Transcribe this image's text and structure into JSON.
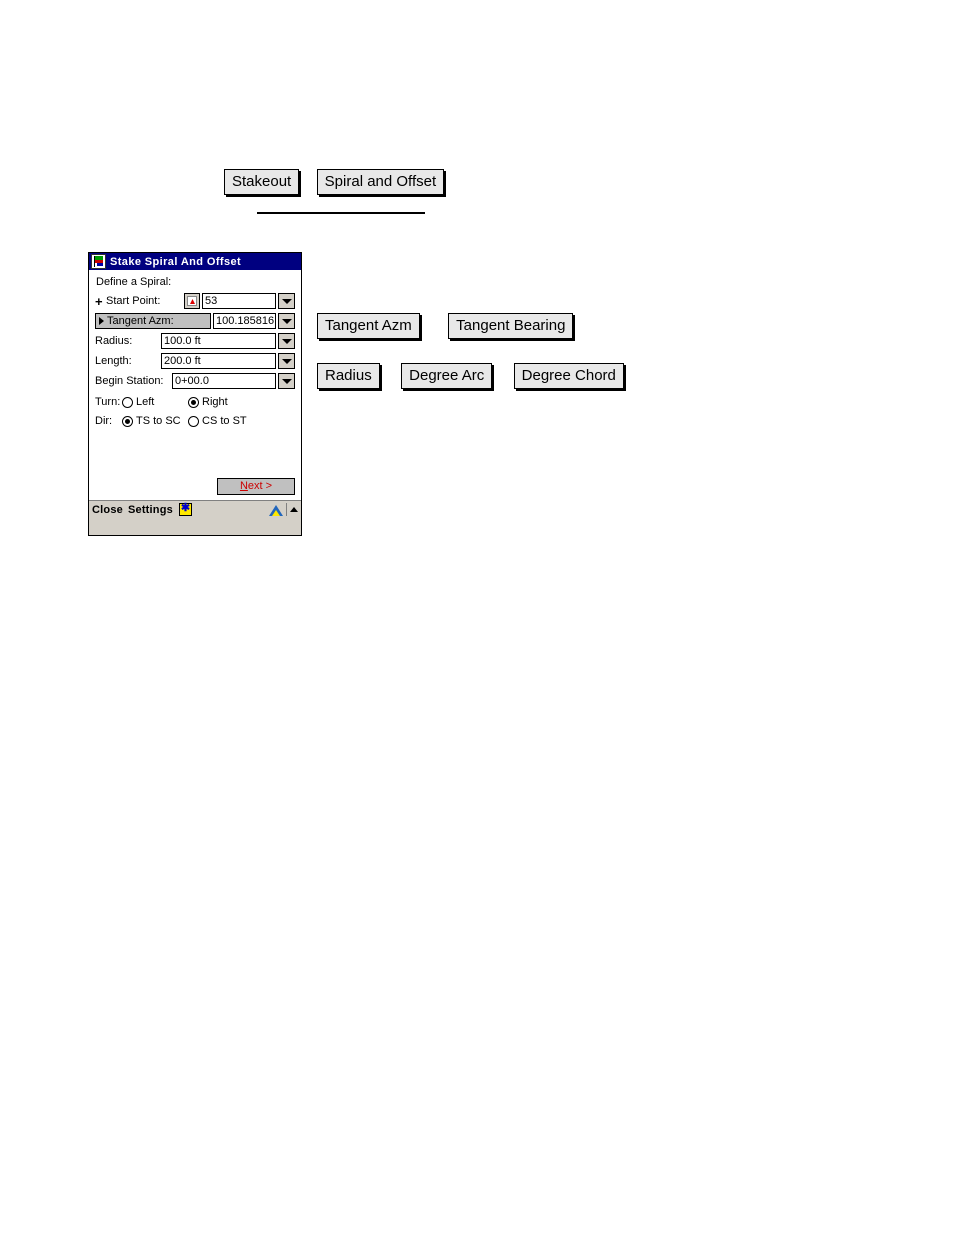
{
  "reference_buttons": {
    "stakeout_row": [
      {
        "label": "Stakeout",
        "name": "stakeout-button"
      },
      {
        "label": "Spiral and Offset",
        "name": "spiral-and-offset-button"
      }
    ],
    "azimuth_row": [
      {
        "label": "Tangent Azm",
        "name": "tangent-azm-button"
      },
      {
        "label": "Tangent Bearing",
        "name": "tangent-bearing-button"
      }
    ],
    "curve_row": [
      {
        "label": "Radius",
        "name": "radius-button"
      },
      {
        "label": "Degree Arc",
        "name": "degree-arc-button"
      },
      {
        "label": "Degree Chord",
        "name": "degree-chord-button"
      }
    ]
  },
  "dialog": {
    "title": "Stake Spiral And Offset",
    "title_bar_color": "#000080",
    "title_text_color": "#FFFFFF",
    "section_label": "Define a Spiral:",
    "fields": {
      "start_point": {
        "label": "Start Point:",
        "value": "53"
      },
      "tangent_azm": {
        "label": "Tangent Azm:",
        "value": "100.185816"
      },
      "radius": {
        "label": "Radius:",
        "value": "100.0 ft"
      },
      "length": {
        "label": "Length:",
        "value": "200.0 ft"
      },
      "begin_station": {
        "label": "Begin Station:",
        "value": "0+00.0"
      }
    },
    "turn": {
      "label": "Turn:",
      "options": [
        {
          "label": "Left",
          "selected": false
        },
        {
          "label": "Right",
          "selected": true
        }
      ]
    },
    "dir": {
      "label": "Dir:",
      "options": [
        {
          "label": "TS to SC",
          "selected": true
        },
        {
          "label": "CS to ST",
          "selected": false
        }
      ]
    },
    "next_button": {
      "prefix": "N",
      "suffix": "ext >",
      "text_color": "#CC0000"
    },
    "status_bar": {
      "close_label": "Close",
      "settings_label": "Settings"
    }
  }
}
